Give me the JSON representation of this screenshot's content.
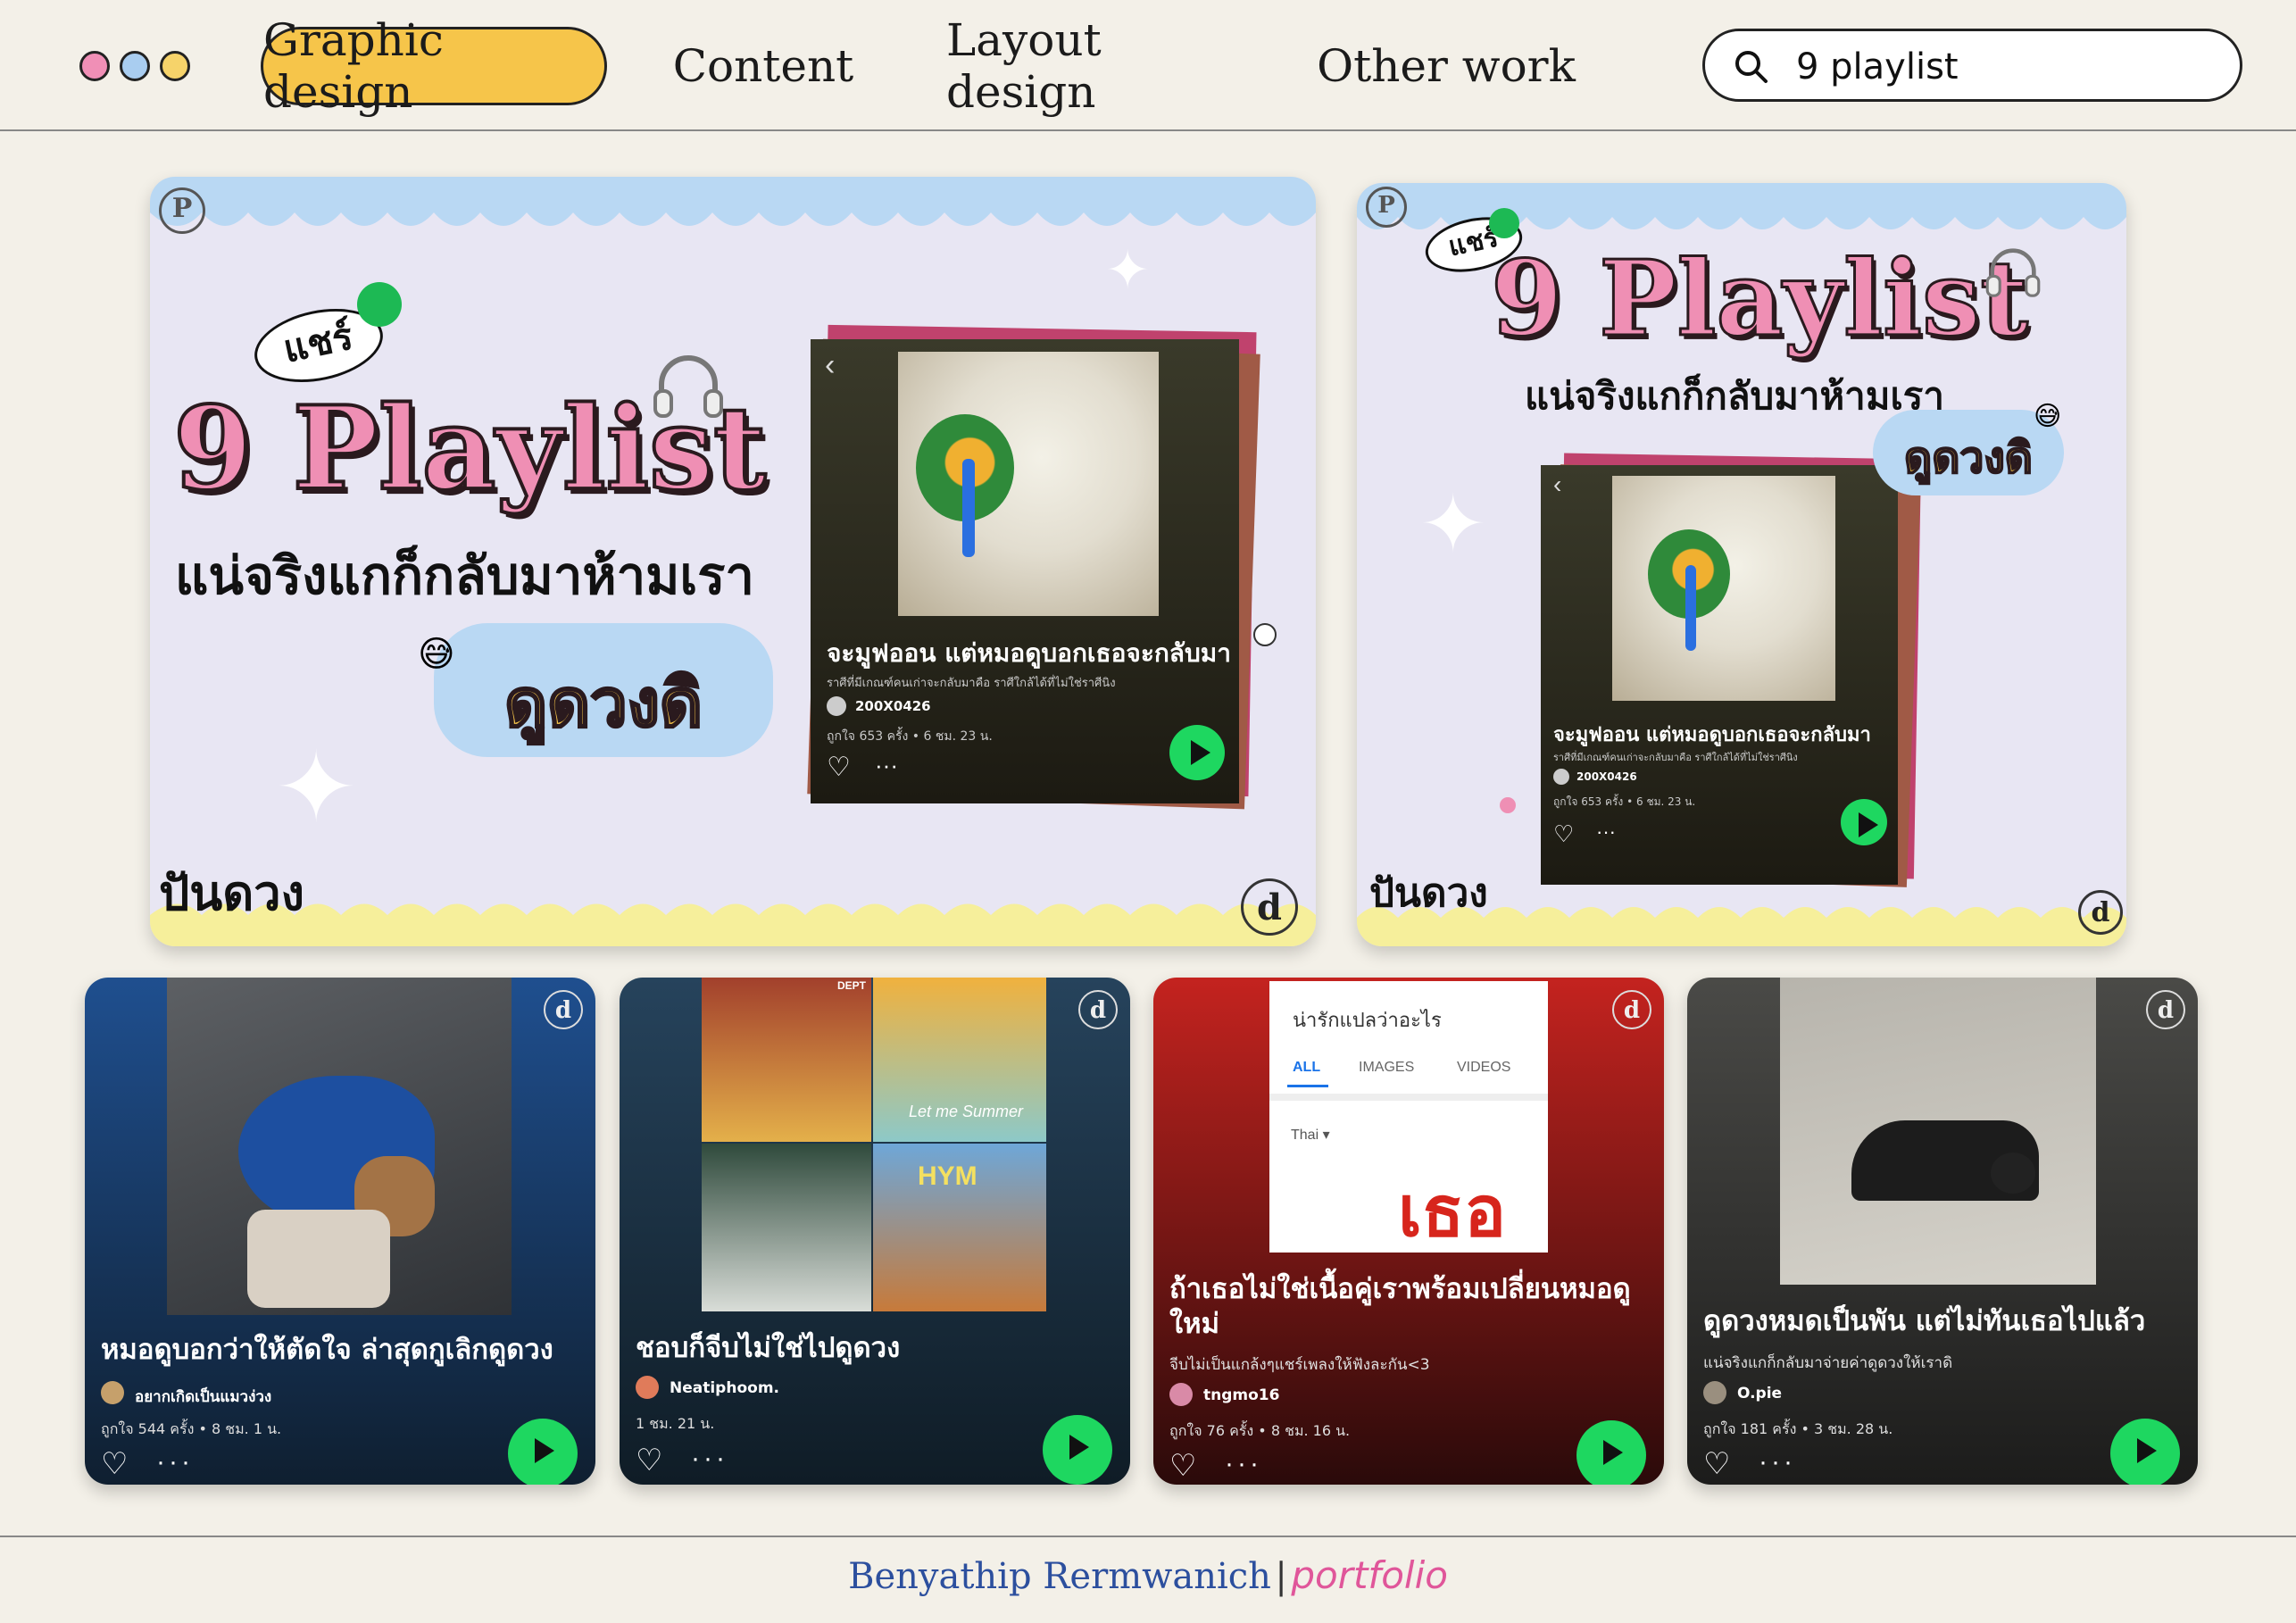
{
  "nav": {
    "dots": [
      "#f08fb6",
      "#a9cdf0",
      "#f6d36a"
    ],
    "items": [
      "Graphic design",
      "Content",
      "Layout design",
      "Other work"
    ],
    "active_color": "#f6c54a"
  },
  "search": {
    "value": "9 playlist",
    "icon": "search-icon"
  },
  "banners": [
    {
      "share": "แชร์",
      "title": "9 Playlist",
      "subtitle": "แน่จริงแกก็กลับมาห้ามเรา",
      "tag": "ดูดวงดิ",
      "brand": "ปันดวง",
      "card": {
        "title": "จะมูฟออน แต่หมอดูบอกเธอจะกลับมา",
        "desc": "ราศีที่มีเกณฑ์คนเก่าจะกลับมาคือ ราศีใกล้ได้ที่ไม่ใช่ราศีนิง",
        "user": "200X0426",
        "stats": "ถูกใจ 653 ครั้ง • 6 ชม. 23 น."
      }
    },
    {
      "share": "แชร์",
      "title": "9 Playlist",
      "subtitle": "แน่จริงแกก็กลับมาห้ามเรา",
      "tag": "ดูดวงดิ",
      "brand": "ปันดวง",
      "card": {
        "title": "จะมูฟออน แต่หมอดูบอกเธอจะกลับมา",
        "desc": "ราศีที่มีเกณฑ์คนเก่าจะกลับมาคือ ราศีใกล้ได้ที่ไม่ใช่ราศีนิง",
        "user": "200X0426",
        "stats": "ถูกใจ 653 ครั้ง • 6 ชม. 23 น."
      }
    }
  ],
  "cards": [
    {
      "title": "หมอดูบอกว่าให้ตัดใจ ล่าสุดกูเลิกดูดวง",
      "desc": "",
      "user": "อยากเกิดเป็นแมวง่วง",
      "stats": "ถูกใจ 544 ครั้ง • 8 ชม. 1 น.",
      "bg": "#1f4f8f"
    },
    {
      "title": "ชอบก็จีบไม่ใช่ไปดูดวง",
      "desc": "",
      "user": "Neatiphoom.",
      "stats": "1 ชม. 21 น.",
      "bg": "#26435c",
      "collage": [
        "DEPT",
        "Let me Summer",
        "HYM"
      ]
    },
    {
      "title": "ถ้าเธอไม่ใช่เนื้อคู่เราพร้อมเปลี่ยนหมอดูใหม่",
      "desc": "จีบไม่เป็นแกล้งๆแชร์เพลงให้ฟังละกัน<3",
      "user": "tngmo16",
      "stats": "ถูกใจ 76 ครั้ง • 8 ชม. 16 น.",
      "bg": "#b4201f",
      "translate": {
        "query": "น่ารักแปลว่าอะไร",
        "tabs": [
          "ALL",
          "IMAGES",
          "VIDEOS"
        ],
        "lang": "Thai",
        "result": "เธอ"
      }
    },
    {
      "title": "ดูดวงหมดเป็นพัน แต่ไม่ทันเธอไปแล้ว",
      "desc": "แน่จริงแกก็กลับมาจ่ายค่าดูดวงให้เราดิ",
      "user": "O.pie",
      "stats": "ถูกใจ 181 ครั้ง • 3 ชม. 28 น.",
      "bg": "#3c3c3a"
    }
  ],
  "footer": {
    "name": "Benyathip Rermwanich",
    "separator": "|",
    "portfolio": "portfolio"
  }
}
